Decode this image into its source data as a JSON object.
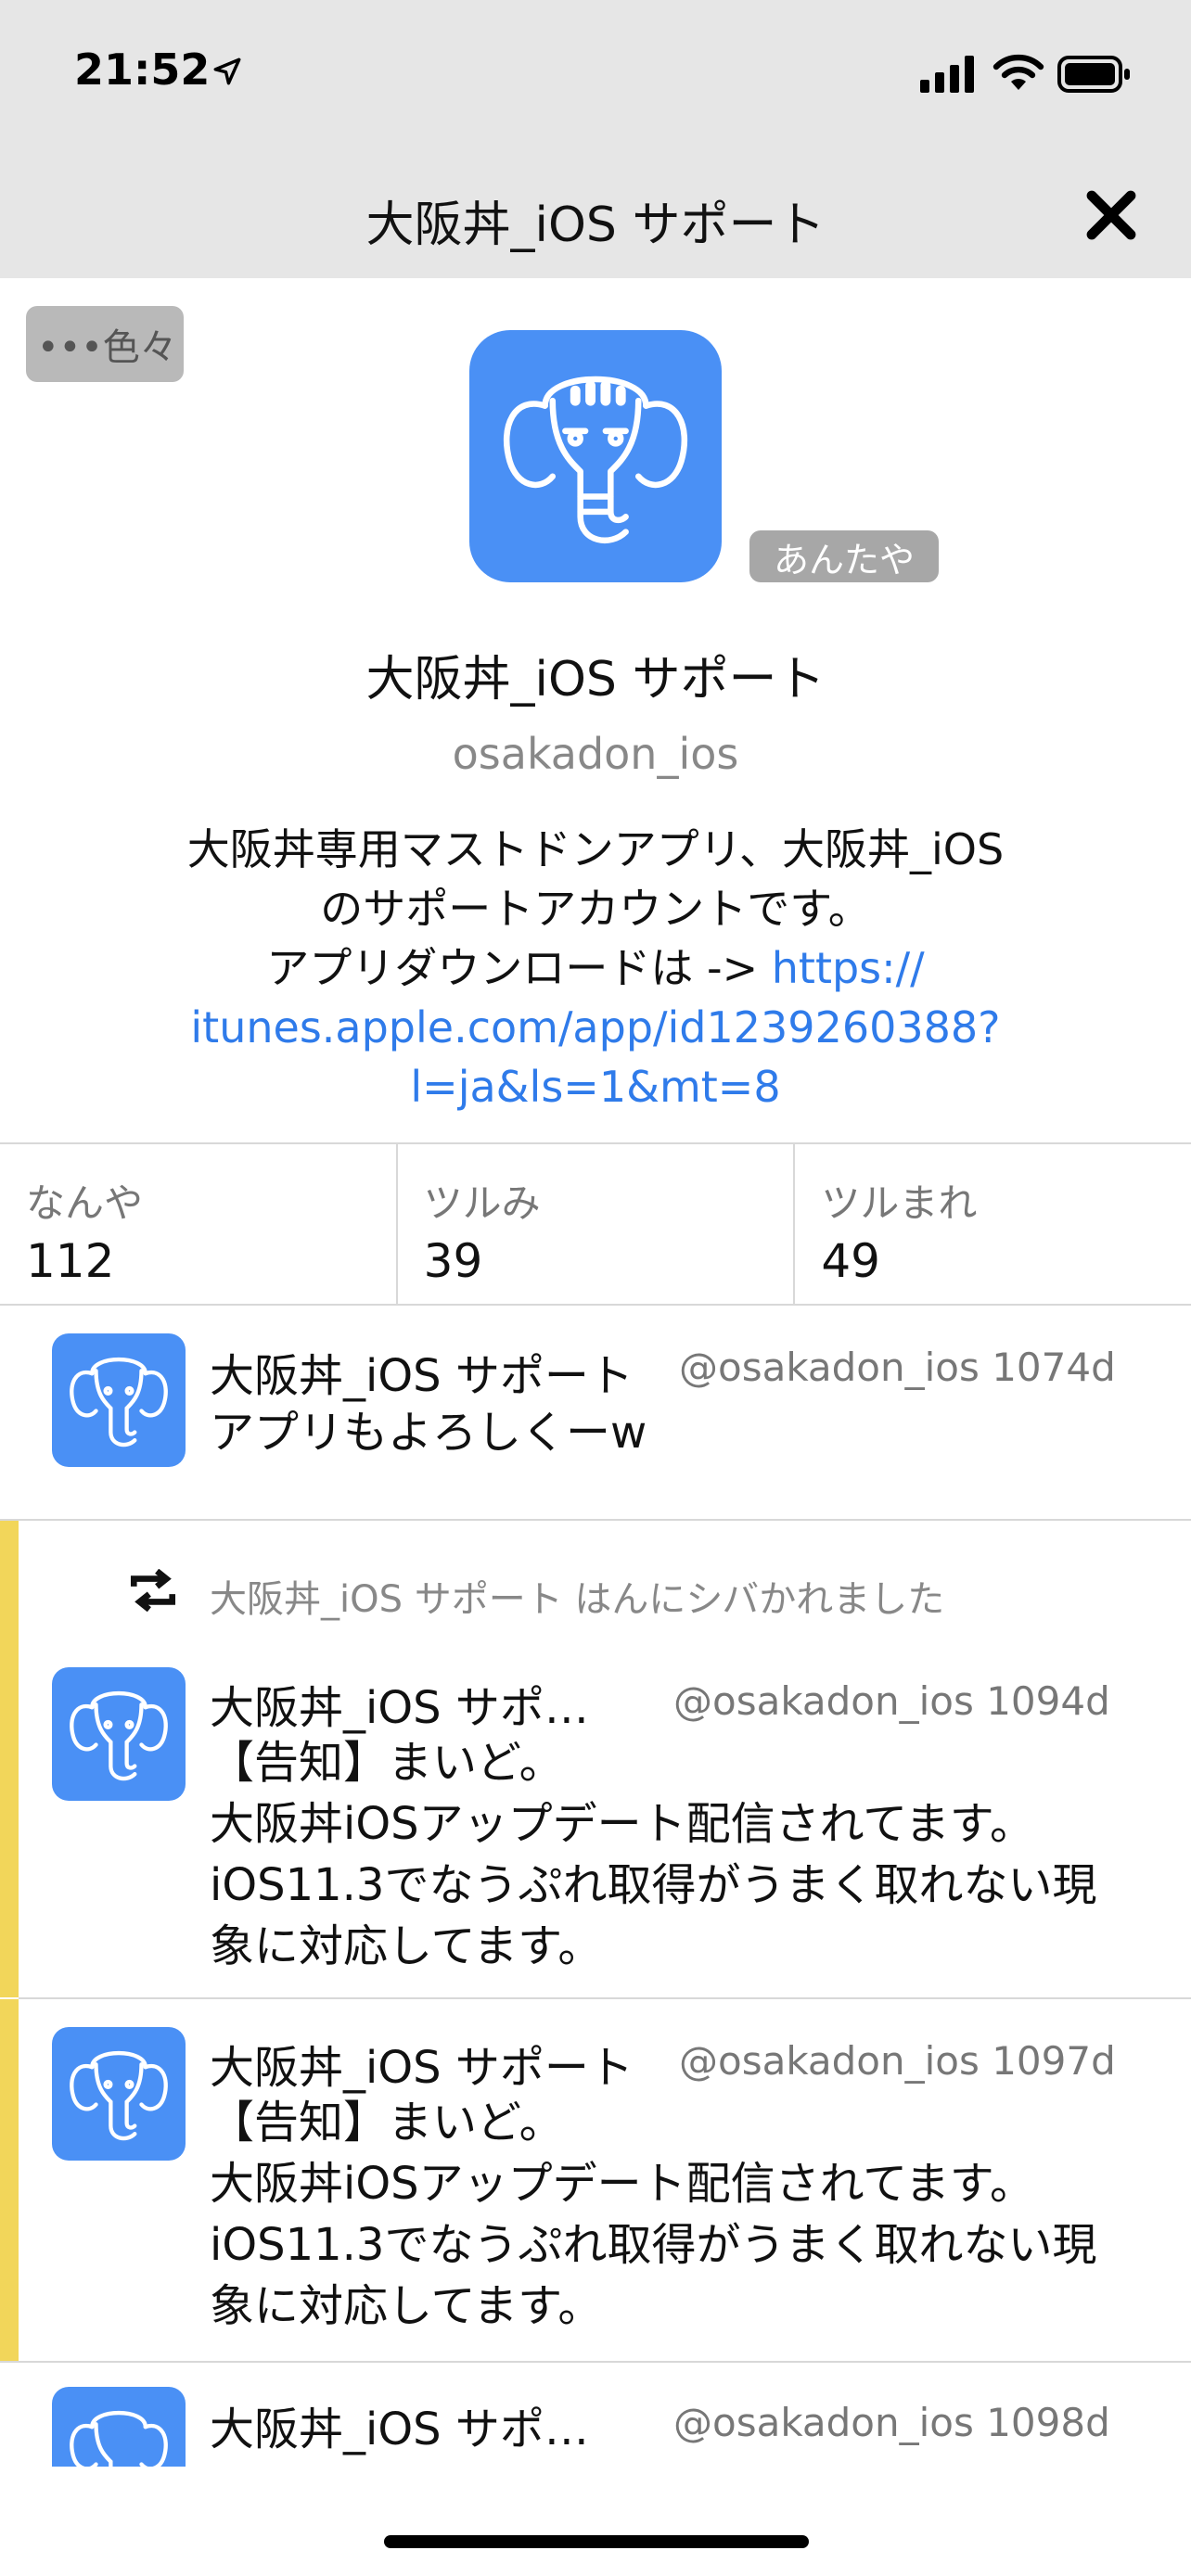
{
  "status": {
    "time": "21:52"
  },
  "nav": {
    "title": "大阪丼_iOS サポート"
  },
  "profile": {
    "menu_label": "•••色々",
    "reply_label": "あんたや",
    "display_name": "大阪丼_iOS サポート",
    "account": "osakadon_ios",
    "bio_line1": "大阪丼専用マストドンアプリ、大阪丼_iOS",
    "bio_line2": "のサポートアカウントです。",
    "bio_line3": "アプリダウンロードは -> ",
    "bio_link_1": "https://",
    "bio_link_2": "itunes.apple.com/app/id1239260388?",
    "bio_link_3": "l=ja&ls=1&mt=8"
  },
  "stats": [
    {
      "label": "なんや",
      "value": "112"
    },
    {
      "label": "ツルみ",
      "value": "39"
    },
    {
      "label": "ツルまれ",
      "value": "49"
    }
  ],
  "posts": [
    {
      "name": "大阪丼_iOS サポート",
      "handle": "@osakadon_ios 1074d",
      "body": "アプリもよろしくーw"
    },
    {
      "boost_text": "大阪丼_iOS サポート はんにシバかれました",
      "name": "大阪丼_iOS サポ…",
      "handle": "@osakadon_ios 1094d",
      "body_l1": "【告知】まいど。",
      "body_l2": "大阪丼iOSアップデート配信されてます。",
      "body_l3": "iOS11.3でなうぷれ取得がうまく取れない現",
      "body_l4": "象に対応してます。"
    },
    {
      "name": "大阪丼_iOS サポート",
      "handle": "@osakadon_ios 1097d",
      "body_l1": "【告知】まいど。",
      "body_l2": "大阪丼iOSアップデート配信されてます。",
      "body_l3": "iOS11.3でなうぷれ取得がうまく取れない現",
      "body_l4": "象に対応してます。"
    },
    {
      "name": "大阪丼_iOS サポ…",
      "handle": "@osakadon_ios 1098d"
    }
  ],
  "colors": {
    "accent_link": "#2f7bea",
    "avatar_bg": "#4a90f5",
    "boost_bar": "#f2d65a"
  }
}
